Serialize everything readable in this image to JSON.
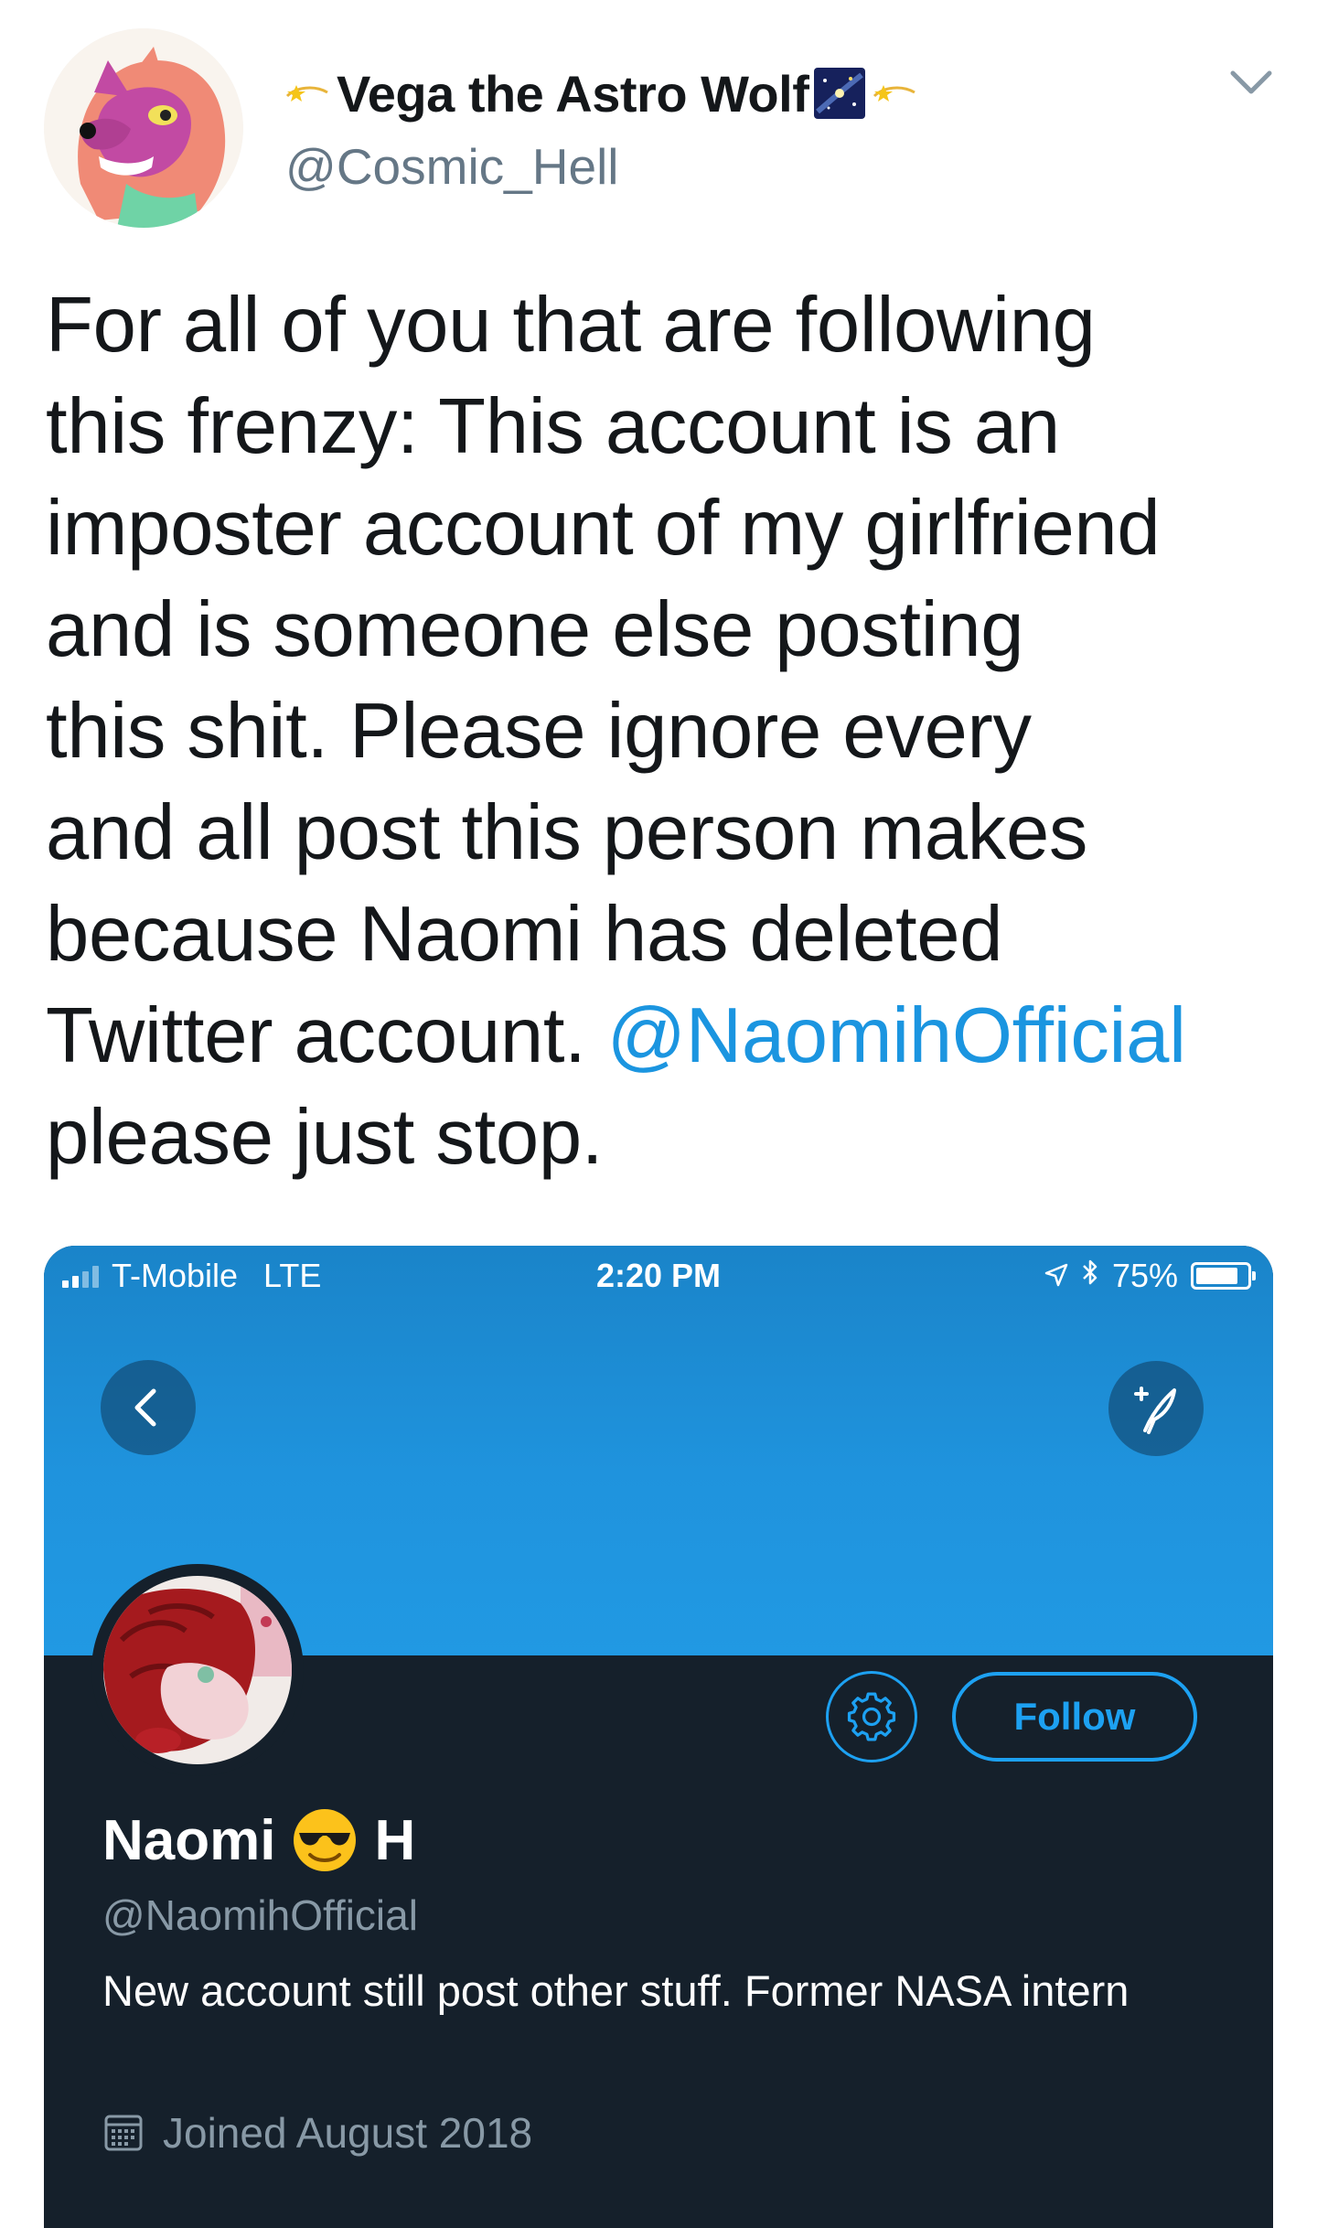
{
  "tweet": {
    "author": {
      "display_name": "Vega the Astro Wolf",
      "handle": "@Cosmic_Hell",
      "decor_icons": [
        "dizzy-star-emoji",
        "milky-way-emoji",
        "dizzy-star-emoji"
      ]
    },
    "text_lines": [
      "For all of you that are following",
      "this frenzy: This account is an",
      "imposter account of my girlfriend",
      "and is someone else posting",
      "this shit. Please ignore every",
      "and all post this person makes",
      "because Naomi has deleted",
      "Twitter account. ",
      "please just stop."
    ],
    "mention": "@NaomihOfficial",
    "menu_icon": "chevron-down-icon"
  },
  "screenshot": {
    "status_bar": {
      "carrier": "T-Mobile",
      "network": "LTE",
      "time": "2:20 PM",
      "battery": "75%",
      "icons": [
        "signal-icon",
        "location-arrow-icon",
        "bluetooth-icon",
        "battery-icon"
      ]
    },
    "nav": {
      "back_icon": "chevron-left-icon",
      "compose_icon": "compose-tweet-icon"
    },
    "profile": {
      "name_first": "Naomi",
      "name_emoji": "sunglasses-emoji",
      "name_last": "H",
      "handle": "@NaomihOfficial",
      "bio": "New account still post other stuff. Former NASA intern",
      "joined": "Joined August 2018",
      "follow_label": "Follow",
      "settings_icon": "gear-icon"
    }
  },
  "colors": {
    "link_blue": "#1b95e0",
    "twitter_blue": "#1da1f2",
    "dark_background": "#15202b",
    "muted_text": "#657786",
    "dark_muted_text": "#8899a6",
    "banner_blue": "#1f93dd"
  }
}
